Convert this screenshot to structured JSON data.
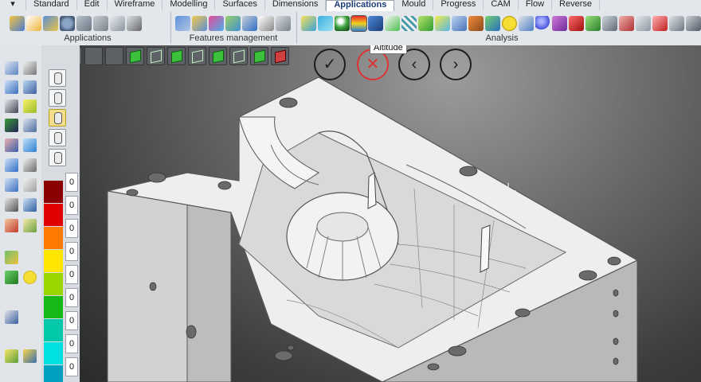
{
  "ribbon": {
    "tabs": [
      {
        "label": "Standard",
        "active": false
      },
      {
        "label": "Edit",
        "active": false
      },
      {
        "label": "Wireframe",
        "active": false
      },
      {
        "label": "Modelling",
        "active": false
      },
      {
        "label": "Surfaces",
        "active": false
      },
      {
        "label": "Dimensions",
        "active": false
      },
      {
        "label": "Applications",
        "active": true
      },
      {
        "label": "Mould",
        "active": false
      },
      {
        "label": "Progress",
        "active": false
      },
      {
        "label": "CAM",
        "active": false
      },
      {
        "label": "Flow",
        "active": false
      },
      {
        "label": "Reverse",
        "active": false
      }
    ],
    "groups": {
      "applications": "Applications",
      "features": "Features management",
      "analysis": "Analysis"
    }
  },
  "tooltip": "Altitude",
  "legend": {
    "values": [
      "0",
      "0",
      "0",
      "0",
      "0",
      "0",
      "0",
      "0",
      "0"
    ],
    "colors": [
      "#8b0000",
      "#e00000",
      "#ff7a00",
      "#ffe600",
      "#9ad600",
      "#18b818",
      "#00c8a8",
      "#00e0e0",
      "#00a0c0"
    ]
  },
  "colors": {
    "accent": "#1a3d7a",
    "cancel": "#dd3333",
    "part": "#e6e6e6"
  },
  "icons": {
    "confirm": "checkmark-icon",
    "cancel": "close-icon",
    "prev": "chevron-left-icon",
    "next": "chevron-right-icon",
    "cursor": "crosshair-cursor-icon"
  },
  "glyphs": {
    "tab_arrow": "▾",
    "confirm": "✓",
    "cancel": "✕",
    "prev": "‹",
    "next": "›"
  }
}
